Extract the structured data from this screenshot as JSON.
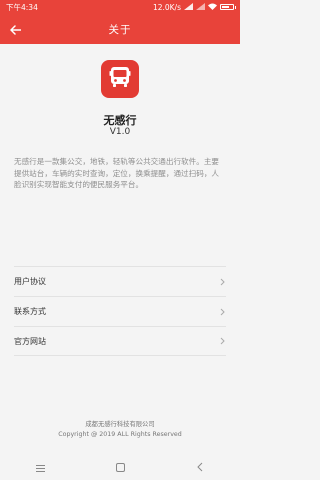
{
  "status_bar": {
    "time": "下午4:34",
    "speed": "12.0K/s",
    "battery": "73",
    "signal_icon": "signal-icon",
    "wifi_icon": "wifi-icon",
    "battery_level": 0.73
  },
  "toolbar": {
    "title": "关于",
    "back_icon": "arrow-left-icon"
  },
  "app": {
    "logo_icon": "bus-icon",
    "name": "无感行",
    "version": "V1.0",
    "description": "无感行是一款集公交，地铁，轻轨等公共交通出行软件。主要提供站台，车辆的实时查询，定位，换乘提醒，通过扫码，人脸识别实现智能支付的便民服务平台。"
  },
  "menu": [
    {
      "label": "用户协议",
      "icon": "chevron-right-icon"
    },
    {
      "label": "联系方式",
      "icon": "chevron-right-icon"
    },
    {
      "label": "官方网站",
      "icon": "chevron-right-icon"
    }
  ],
  "footer": {
    "company": "成都无感行科技有限公司",
    "copyright": "Copyright @ 2019 ALL Rights Reserved"
  },
  "nav_bar": {
    "menu_icon": "menu-icon",
    "home_icon": "square-icon",
    "back_icon": "chevron-left-icon"
  },
  "colors": {
    "brand": "#e8433a",
    "background": "#f4f4f4"
  }
}
